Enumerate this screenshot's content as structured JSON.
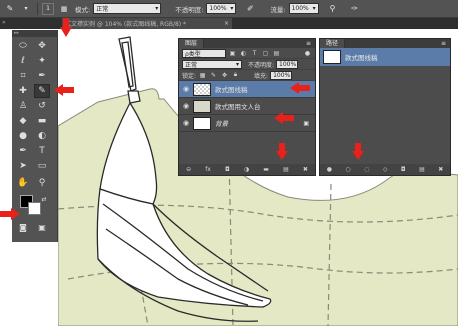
{
  "options_bar": {
    "mode_label": "模式:",
    "mode_value": "正常",
    "opacity_label": "不透明度:",
    "opacity_value": "100%",
    "flow_label": "流量:",
    "flow_value": "100%"
  },
  "tab": {
    "title": "式文襟实例 @ 104% (款式图线稿, RGB/8) *",
    "close": "×"
  },
  "layers_panel": {
    "tab_label": "图层",
    "filter_label": "ρ类型",
    "blend_value": "正常",
    "opacity_label": "不透明度:",
    "opacity_value": "100%",
    "lock_label": "锁定:",
    "fill_label": "填充:",
    "fill_value": "100%",
    "layers": [
      {
        "name": "款式图线稿",
        "active": true
      },
      {
        "name": "款式图用文人台",
        "active": false
      },
      {
        "name": "背景",
        "active": false
      }
    ]
  },
  "paths_panel": {
    "tab_label": "路径",
    "path_name": "款式图线稿"
  },
  "colors": {
    "accent_red": "#e8211b",
    "panel_bg": "#4c4c4c",
    "selection_blue": "#5b7ca8",
    "dress_form": "#e4e8c4"
  },
  "icons": {
    "eye": "eye-icon",
    "brush": "brush-icon",
    "lock": "lock-icon"
  }
}
